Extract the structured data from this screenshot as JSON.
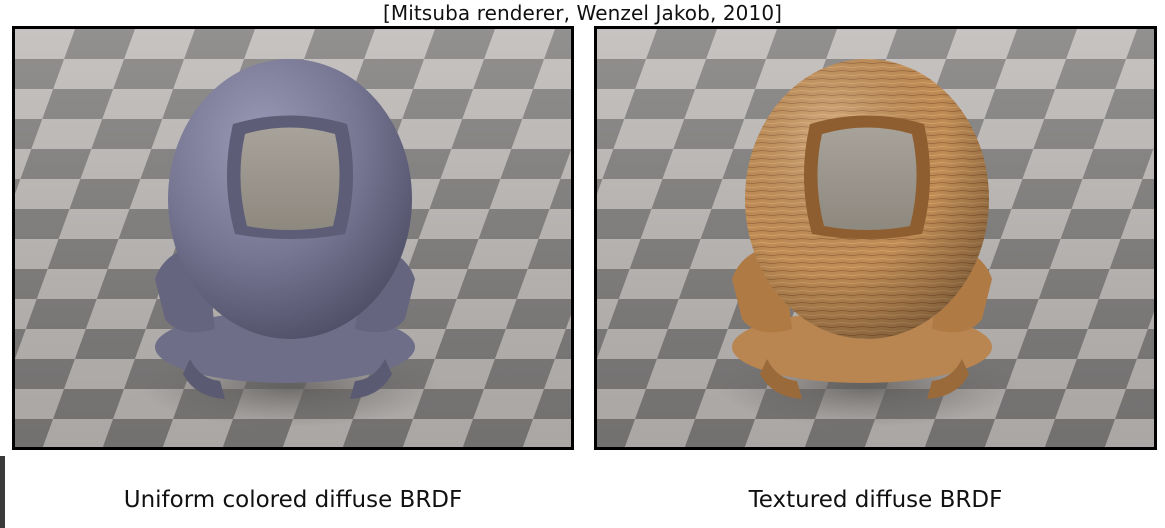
{
  "citation": "[Mitsuba renderer, Wenzel Jakob, 2010]",
  "panels": [
    {
      "image_name": "uniform-diffuse-render",
      "caption": "Uniform colored diffuse BRDF",
      "material_color": "#7a7a96"
    },
    {
      "image_name": "textured-diffuse-render",
      "caption": "Textured diffuse BRDF",
      "material_color": "#c8955a"
    }
  ],
  "colors": {
    "checker_light": "#b8b4b2",
    "checker_dark": "#7c7a79",
    "frame": "#000000",
    "inset": "#9e988e"
  },
  "icons": [
    "none"
  ]
}
